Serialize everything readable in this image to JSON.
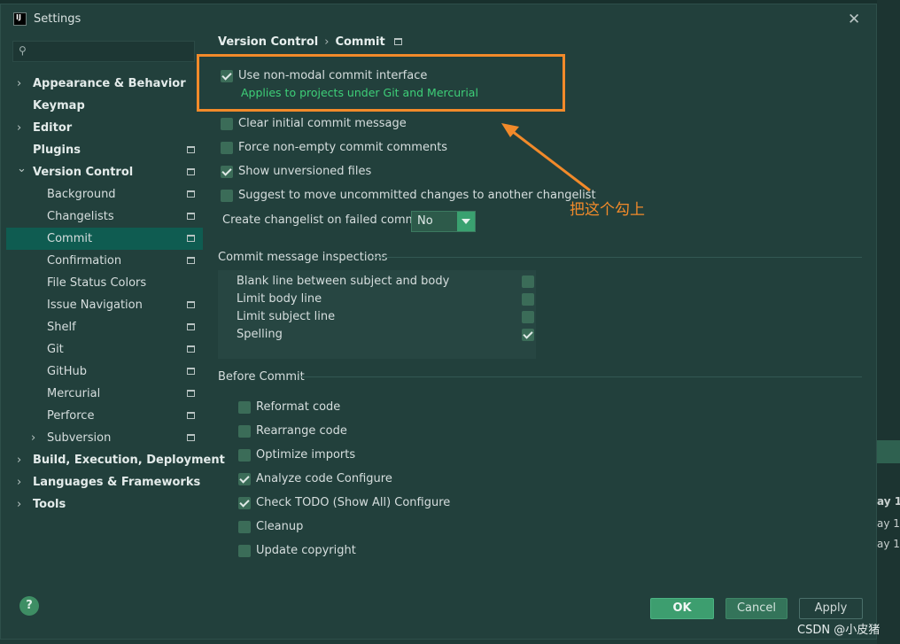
{
  "window": {
    "title": "Settings",
    "app_icon_text": "IJ",
    "close_glyph": "✕"
  },
  "search": {
    "value": "",
    "placeholder": ""
  },
  "sidebar": {
    "items": [
      {
        "label": "Appearance & Behavior",
        "level": 0,
        "bold": true,
        "arrow": "›",
        "project": false
      },
      {
        "label": "Keymap",
        "level": 0,
        "bold": true,
        "arrow": "",
        "project": false
      },
      {
        "label": "Editor",
        "level": 0,
        "bold": true,
        "arrow": "›",
        "project": false
      },
      {
        "label": "Plugins",
        "level": 0,
        "bold": true,
        "arrow": "",
        "project": true
      },
      {
        "label": "Version Control",
        "level": 0,
        "bold": true,
        "arrow": "⌄",
        "project": true
      },
      {
        "label": "Background",
        "level": 1,
        "bold": false,
        "arrow": "",
        "project": true
      },
      {
        "label": "Changelists",
        "level": 1,
        "bold": false,
        "arrow": "",
        "project": true
      },
      {
        "label": "Commit",
        "level": 1,
        "bold": false,
        "arrow": "",
        "project": true,
        "selected": true
      },
      {
        "label": "Confirmation",
        "level": 1,
        "bold": false,
        "arrow": "",
        "project": true
      },
      {
        "label": "File Status Colors",
        "level": 1,
        "bold": false,
        "arrow": "",
        "project": false
      },
      {
        "label": "Issue Navigation",
        "level": 1,
        "bold": false,
        "arrow": "",
        "project": true
      },
      {
        "label": "Shelf",
        "level": 1,
        "bold": false,
        "arrow": "",
        "project": true
      },
      {
        "label": "Git",
        "level": 1,
        "bold": false,
        "arrow": "",
        "project": true
      },
      {
        "label": "GitHub",
        "level": 1,
        "bold": false,
        "arrow": "",
        "project": true
      },
      {
        "label": "Mercurial",
        "level": 1,
        "bold": false,
        "arrow": "",
        "project": true
      },
      {
        "label": "Perforce",
        "level": 1,
        "bold": false,
        "arrow": "",
        "project": true
      },
      {
        "label": "Subversion",
        "level": 1,
        "bold": false,
        "arrow": "›",
        "project": true
      },
      {
        "label": "Build, Execution, Deployment",
        "level": 0,
        "bold": true,
        "arrow": "›",
        "project": false
      },
      {
        "label": "Languages & Frameworks",
        "level": 0,
        "bold": true,
        "arrow": "›",
        "project": false
      },
      {
        "label": "Tools",
        "level": 0,
        "bold": true,
        "arrow": "›",
        "project": false
      }
    ]
  },
  "breadcrumb": {
    "parent": "Version Control",
    "separator": "›",
    "current": "Commit"
  },
  "options": {
    "non_modal": {
      "label": "Use non-modal commit interface",
      "checked": true,
      "hint": "Applies to projects under Git and Mercurial"
    },
    "clear_initial": {
      "label": "Clear initial commit message",
      "checked": false
    },
    "force_non_empty": {
      "label": "Force non-empty commit comments",
      "checked": false
    },
    "show_unversioned": {
      "label": "Show unversioned files",
      "checked": true
    },
    "suggest_move": {
      "label": "Suggest to move uncommitted changes to another changelist",
      "checked": false
    }
  },
  "failed_commit": {
    "label": "Create changelist on failed commit:",
    "value": "No"
  },
  "inspections": {
    "header": "Commit message inspections",
    "items": [
      {
        "label": "Blank line between subject and body",
        "checked": false
      },
      {
        "label": "Limit body line",
        "checked": false
      },
      {
        "label": "Limit subject line",
        "checked": false
      },
      {
        "label": "Spelling",
        "checked": true
      }
    ]
  },
  "before_commit": {
    "header": "Before Commit",
    "items": [
      {
        "label": "Reformat code",
        "checked": false
      },
      {
        "label": "Rearrange code",
        "checked": false
      },
      {
        "label": "Optimize imports",
        "checked": false
      },
      {
        "label": "Analyze code Configure",
        "checked": true
      },
      {
        "label": "Check TODO (Show All) Configure",
        "checked": true
      },
      {
        "label": "Cleanup",
        "checked": false
      },
      {
        "label": "Update copyright",
        "checked": false
      }
    ]
  },
  "buttons": {
    "ok": "OK",
    "cancel": "Cancel",
    "apply": "Apply",
    "help": "?"
  },
  "annotation": {
    "text": "把这个勾上",
    "color": "#f28a2a"
  },
  "watermark": "CSDN @小皮猪",
  "background_snippets": [
    "ay 1",
    "ay 1",
    "ay 1"
  ],
  "colors": {
    "accent": "#3d9e6f",
    "hint": "#3ecf78",
    "highlight": "#f28a2a",
    "selection": "#0f5c51"
  }
}
